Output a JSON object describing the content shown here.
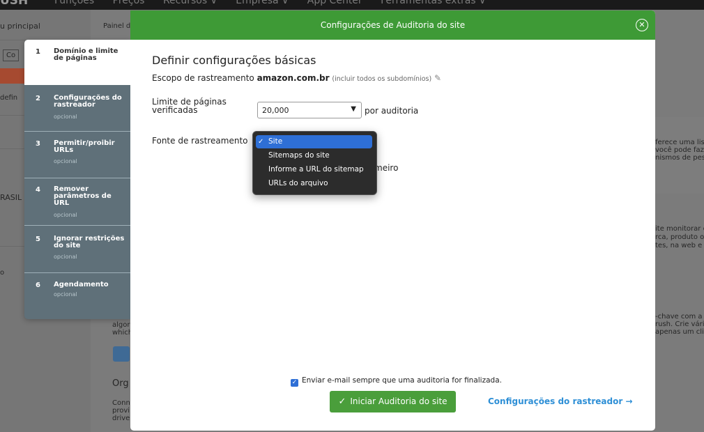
{
  "background": {
    "logo": "USH",
    "nav": [
      "Funções",
      "Preços",
      "Recursos ∨",
      "Empresa ∨",
      "App Center",
      "Ferramentas extras ∨"
    ],
    "menu_principal": "u principal",
    "painel": "Painel d",
    "defin": "defin",
    "co": "Co",
    "rasil": "RASIL",
    "o": "o",
    "right_snippets": [
      "ferece uma lista",
      "você pode faze",
      "nismos de peso",
      "ite monitorar c",
      "rca, produto ou",
      "tes, na web e e",
      "-chave com a",
      "rush. Crie vária",
      " apenas um clic"
    ],
    "left_snippets": [
      "algor",
      "which",
      "Org",
      "Conn",
      "provi",
      "drive"
    ]
  },
  "wizard": {
    "steps": [
      {
        "num": "1",
        "title": "Domínio e limite de páginas",
        "sub": ""
      },
      {
        "num": "2",
        "title": "Configurações do rastreador",
        "sub": "opcional"
      },
      {
        "num": "3",
        "title": "Permitir/proibir URLs",
        "sub": "opcional"
      },
      {
        "num": "4",
        "title": "Remover parâmetros de URL",
        "sub": "opcional"
      },
      {
        "num": "5",
        "title": "Ignorar restrições do site",
        "sub": "opcional"
      },
      {
        "num": "6",
        "title": "Agendamento",
        "sub": "opcional"
      }
    ]
  },
  "modal": {
    "title": "Configurações de Auditoria do site",
    "heading": "Definir configurações básicas",
    "scope_label": "Escopo de rastreamento",
    "domain": "amazon.com.br",
    "scope_note": "(incluir todos os subdomínios)",
    "limit_label": "Limite de páginas verificadas",
    "limit_value": "20,000",
    "limit_after": "por auditoria",
    "source_label": "Fonte de rastreamento",
    "hidden_text": "meiro",
    "source_options": [
      {
        "label": "Site",
        "selected": true
      },
      {
        "label": "Sitemaps do site",
        "selected": false
      },
      {
        "label": "Informe a URL do sitemap",
        "selected": false
      },
      {
        "label": "URLs do arquivo",
        "selected": false
      }
    ],
    "email_label": "Enviar e-mail sempre que uma auditoria for finalizada.",
    "email_checked": true,
    "start_button": "Iniciar Auditoria do site",
    "next_link": "Configurações do rastreador →"
  }
}
